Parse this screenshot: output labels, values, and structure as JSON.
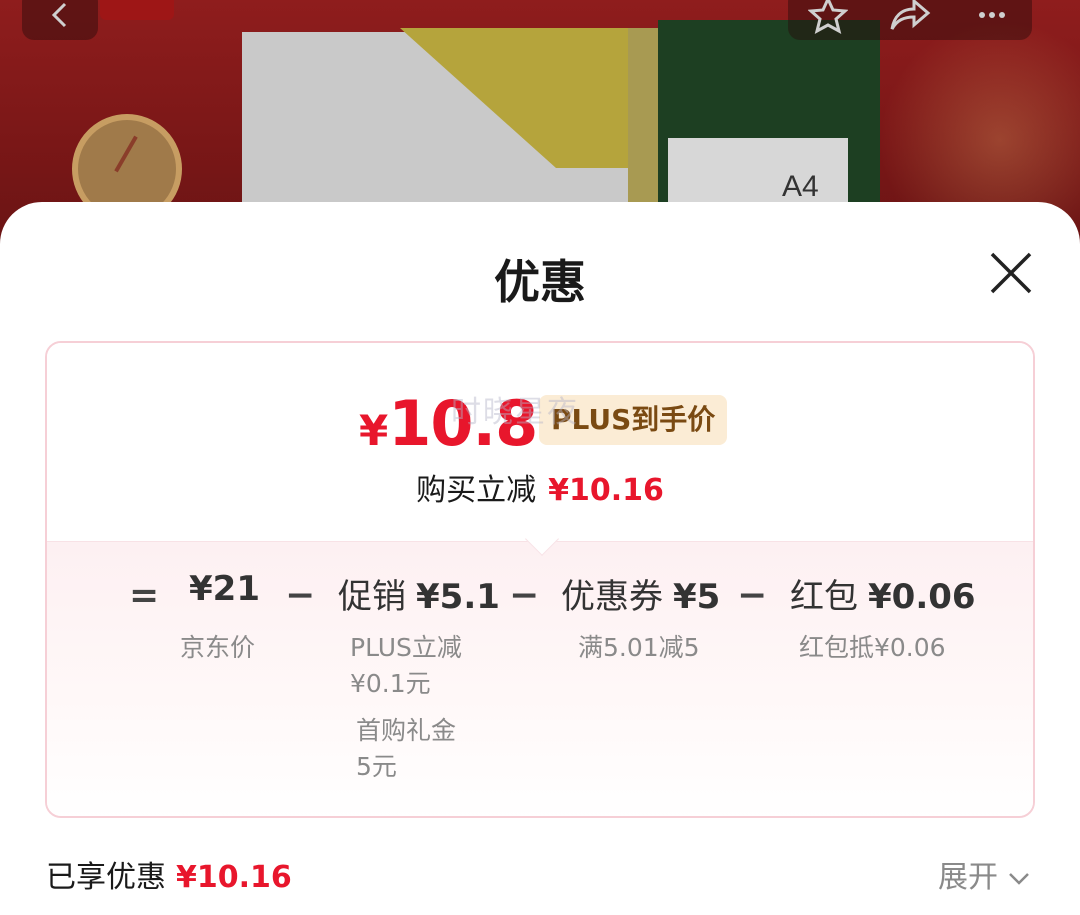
{
  "background": {
    "paper_size_label": "A4"
  },
  "sheet": {
    "title": "优惠"
  },
  "price_card": {
    "currency_symbol": "¥",
    "final_price": "10.84",
    "price_tag": "PLUS到手价",
    "watermark": "时晓星夜",
    "saving_label": "购买立减",
    "saving_amount": "¥10.16"
  },
  "breakdown": {
    "equals_sign": "=",
    "minus_sign": "−",
    "items": [
      {
        "label": "",
        "value": "¥21",
        "notes": [
          "京东价"
        ]
      },
      {
        "label": "促销",
        "value": "¥5.1",
        "notes": [
          "PLUS立减",
          "¥0.1元",
          "首购礼金",
          "5元"
        ]
      },
      {
        "label": "优惠券",
        "value": "¥5",
        "notes": [
          "满5.01减5"
        ]
      },
      {
        "label": "红包",
        "value": "¥0.06",
        "notes": [
          "红包抵¥0.06"
        ]
      }
    ]
  },
  "enjoyed": {
    "label": "已享优惠",
    "amount": "¥10.16",
    "expand_label": "展开"
  },
  "colors": {
    "accent_red": "#e8162c",
    "tag_bg": "#fbecd5",
    "tag_text": "#7a4a12",
    "card_border": "#f6cfd6"
  },
  "icons": [
    "back-arrow-icon",
    "star-icon",
    "share-icon",
    "more-icon",
    "close-icon",
    "chevron-down-icon"
  ]
}
